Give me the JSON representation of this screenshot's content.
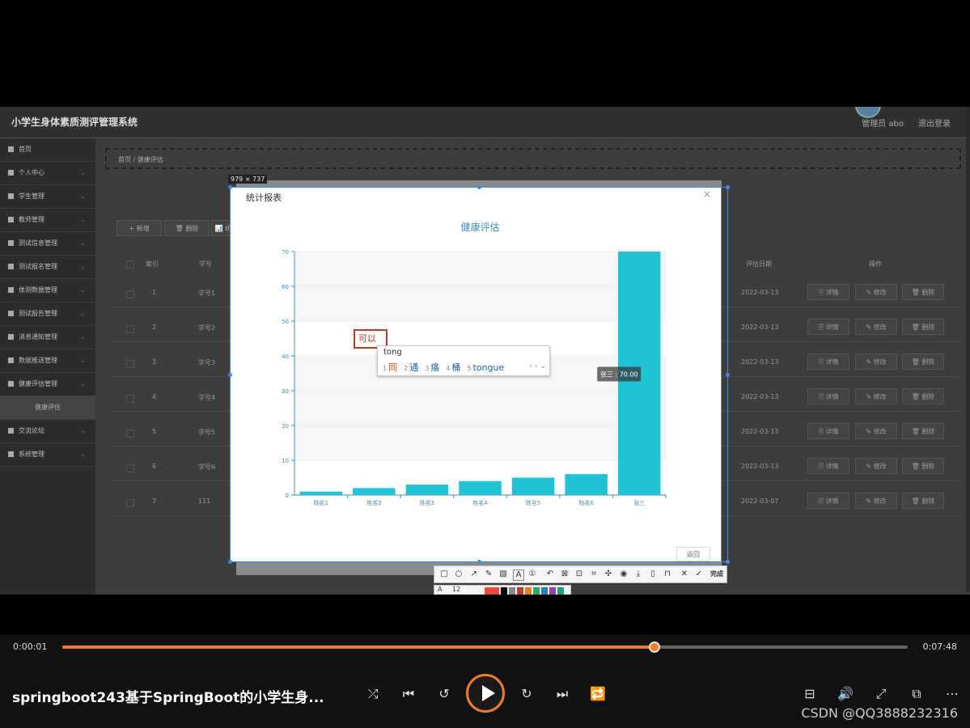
{
  "app": {
    "title": "小学生身体素质测评管理系统",
    "user_label": "管理员 abo",
    "logout_label": "退出登录",
    "sidebar": [
      {
        "label": "首页",
        "chevron": false
      },
      {
        "label": "个人中心",
        "chevron": true
      },
      {
        "label": "学生管理",
        "chevron": true
      },
      {
        "label": "教师管理",
        "chevron": true
      },
      {
        "label": "测试信息管理",
        "chevron": true
      },
      {
        "label": "测试报名管理",
        "chevron": true
      },
      {
        "label": "体测数据管理",
        "chevron": true
      },
      {
        "label": "测试报告管理",
        "chevron": true
      },
      {
        "label": "消息通知管理",
        "chevron": true
      },
      {
        "label": "数据推送管理",
        "chevron": true
      },
      {
        "label": "健康评估管理",
        "chevron": true
      },
      {
        "label": "健康评估",
        "chevron": false,
        "sub": true
      },
      {
        "label": "交流论坛",
        "chevron": true
      },
      {
        "label": "系统管理",
        "chevron": true
      }
    ],
    "breadcrumb": "首页  /  健康评估",
    "toolbar": {
      "add": "+ 新增",
      "delete": "🗑 删除",
      "stats": "📊 统"
    },
    "table": {
      "headers": {
        "index": "索引",
        "student_no": "学号",
        "date": "评估日期",
        "action": "操作"
      },
      "rows": [
        {
          "index": "1",
          "no": "学号1",
          "date": "2022-03-13"
        },
        {
          "index": "2",
          "no": "学号2",
          "date": "2022-03-13"
        },
        {
          "index": "3",
          "no": "学号3",
          "date": "2022-03-13"
        },
        {
          "index": "4",
          "no": "学号4",
          "date": "2022-03-13"
        },
        {
          "index": "5",
          "no": "学号5",
          "date": "2022-03-13"
        },
        {
          "index": "6",
          "no": "学号6",
          "date": "2022-03-13"
        },
        {
          "index": "7",
          "no": "111",
          "date": "2022-03-07"
        }
      ],
      "actions": {
        "detail": "🗎 详情",
        "edit": "✎ 修改",
        "delete": "🗑 删除"
      }
    }
  },
  "screenshot": {
    "size_tag": "979 × 737",
    "toolbar_done": "完成",
    "font_size": "12",
    "colors": [
      "#e74c3c",
      "#000000",
      "#888888",
      "#c0392b",
      "#e67e22",
      "#27ae60",
      "#2980b9",
      "#8e44ad",
      "#16a085"
    ]
  },
  "modal": {
    "title": "统计报表",
    "close": "×",
    "back_label": "返回"
  },
  "ime": {
    "composition": "可以",
    "input": "tong",
    "candidates": [
      {
        "n": "1",
        "t": "同"
      },
      {
        "n": "2",
        "t": "通"
      },
      {
        "n": "3",
        "t": "痛"
      },
      {
        "n": "4",
        "t": "桶"
      },
      {
        "n": "5",
        "t": "tongue"
      }
    ],
    "nav": "‹ › ⌄"
  },
  "chart_data": {
    "type": "bar",
    "title": "健康评估",
    "categories": [
      "姓名1",
      "姓名2",
      "姓名3",
      "姓名4",
      "姓名5",
      "姓名6",
      "张三"
    ],
    "values": [
      1,
      2,
      3,
      4,
      5,
      6,
      70
    ],
    "ylim": [
      0,
      70
    ],
    "yticks": [
      0,
      10,
      20,
      30,
      40,
      50,
      60,
      70
    ],
    "tooltip": "张三 : 70.00",
    "bar_color": "#21c1d6",
    "grid": true
  },
  "player": {
    "current_time": "0:00:01",
    "total_time": "0:07:48",
    "progress": 0.7,
    "title": "springboot243基于SpringBoot的小学生身...",
    "watermark": "CSDN @QQ3888232316"
  }
}
